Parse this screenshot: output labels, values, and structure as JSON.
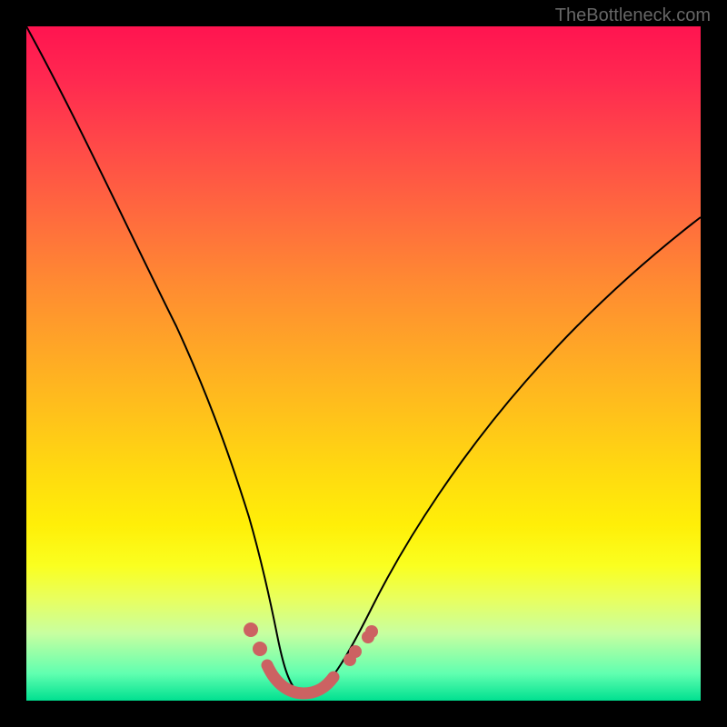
{
  "watermark": "TheBottleneck.com",
  "chart_data": {
    "type": "line",
    "title": "",
    "xlabel": "",
    "ylabel": "",
    "xlim": [
      0,
      100
    ],
    "ylim": [
      0,
      100
    ],
    "series": [
      {
        "name": "bottleneck-curve",
        "x": [
          0,
          5,
          10,
          15,
          20,
          25,
          28,
          31,
          33.5,
          35.5,
          37,
          38.5,
          40,
          42,
          44,
          47,
          52,
          58,
          65,
          75,
          85,
          95,
          100
        ],
        "y": [
          100,
          84,
          69,
          55,
          42,
          30,
          23,
          16,
          10,
          6,
          3,
          1.5,
          1,
          1,
          1.5,
          3,
          8,
          15,
          24,
          36,
          48,
          58,
          63
        ]
      }
    ],
    "markers": {
      "name": "highlighted-points",
      "points": [
        {
          "x": 33.3,
          "y": 10.8
        },
        {
          "x": 34.6,
          "y": 8.0
        },
        {
          "x": 36.2,
          "y": 4.8
        },
        {
          "x": 37.3,
          "y": 3.0
        },
        {
          "x": 38.9,
          "y": 1.8
        },
        {
          "x": 40.5,
          "y": 1.2
        },
        {
          "x": 42.1,
          "y": 1.2
        },
        {
          "x": 43.7,
          "y": 1.6
        },
        {
          "x": 45.3,
          "y": 2.4
        },
        {
          "x": 48.0,
          "y": 5.0
        },
        {
          "x": 48.8,
          "y": 6.0
        },
        {
          "x": 50.6,
          "y": 8.2
        },
        {
          "x": 51.2,
          "y": 9.0
        }
      ]
    },
    "colors": {
      "gradient_top": "#ff1450",
      "gradient_mid": "#ffd000",
      "gradient_bottom": "#00e090",
      "curve": "#000000",
      "marker": "#cc6262"
    }
  }
}
